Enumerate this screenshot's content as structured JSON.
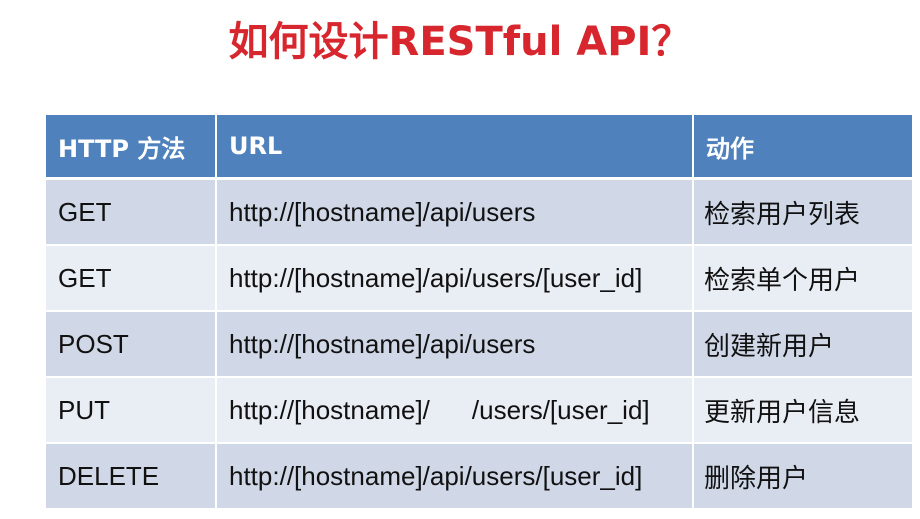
{
  "title": "如何设计RESTful API？",
  "table": {
    "headers": [
      "HTTP 方法",
      "URL",
      "动作"
    ],
    "rows": [
      {
        "method": "GET",
        "url": "http://[hostname]/api/users",
        "action": "检索用户列表"
      },
      {
        "method": "GET",
        "url": "http://[hostname]/api/users/[user_id]",
        "action": "检索单个用户"
      },
      {
        "method": "POST",
        "url": "http://[hostname]/api/users",
        "action": "创建新用户"
      },
      {
        "method": "PUT",
        "url_part1": "http://[hostname]/",
        "url_part2": "/users/[user_id]",
        "action": "更新用户信息"
      },
      {
        "method": "DELETE",
        "url": "http://[hostname]/api/users/[user_id]",
        "action": "删除用户"
      }
    ]
  },
  "colors": {
    "title": "#d7262e",
    "header_bg": "#4f81bd",
    "row_odd": "#d0d8e8",
    "row_even": "#e9edf4"
  }
}
